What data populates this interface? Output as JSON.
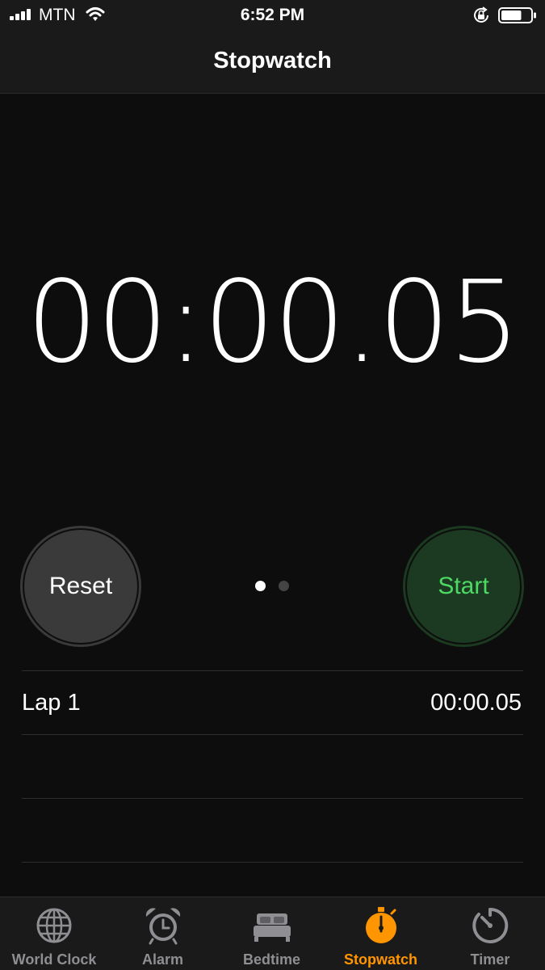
{
  "status_bar": {
    "carrier": "MTN",
    "time": "6:52 PM",
    "signal_icon": "signal-bars-icon",
    "wifi_icon": "wifi-icon",
    "rotation_lock_icon": "rotation-lock-icon",
    "battery_icon": "battery-icon",
    "battery_level": 0.7
  },
  "nav": {
    "title": "Stopwatch"
  },
  "stopwatch": {
    "elapsed": "00:00.05"
  },
  "controls": {
    "reset_label": "Reset",
    "start_label": "Start",
    "page_count": 2,
    "active_page": 1
  },
  "laps": [
    {
      "label": "Lap 1",
      "time": "00:00.05"
    },
    {
      "label": "",
      "time": ""
    },
    {
      "label": "",
      "time": ""
    }
  ],
  "tabs": [
    {
      "label": "World Clock",
      "icon": "globe-icon",
      "active": false
    },
    {
      "label": "Alarm",
      "icon": "alarm-clock-icon",
      "active": false
    },
    {
      "label": "Bedtime",
      "icon": "bed-icon",
      "active": false
    },
    {
      "label": "Stopwatch",
      "icon": "stopwatch-icon",
      "active": true
    },
    {
      "label": "Timer",
      "icon": "timer-icon",
      "active": false
    }
  ],
  "colors": {
    "accent": "#ff9500",
    "start_green": "#4cd964",
    "background": "#0d0d0d"
  }
}
